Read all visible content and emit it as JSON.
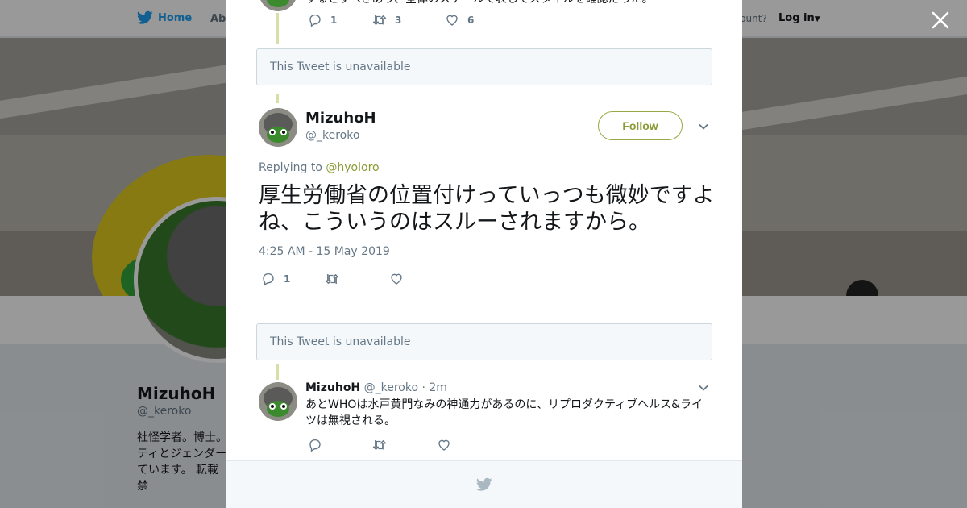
{
  "nav": {
    "home_label": "Home",
    "about_label": "Abo",
    "account_prompt": "ccount?",
    "login_label": "Log in"
  },
  "profile": {
    "name": "MizuhoH",
    "handle": "@_keroko",
    "bio": "社怪学者。博士。\nティとジェンダー\nています。 転載禁\nよ。「占いをまと"
  },
  "colors": {
    "accent": "#8a9a34",
    "thread_line": "#d8dfa6",
    "twitter_blue": "#1da1f2"
  },
  "modal": {
    "top_tweet": {
      "snippet": "するとすべきあり、全体のスケールで表してスタイルを確認だった。",
      "reply_count": "1",
      "retweet_count": "3",
      "like_count": "6"
    },
    "unavailable_1": "This Tweet is unavailable",
    "main_tweet": {
      "name": "MizuhoH",
      "handle": "@_keroko",
      "follow_label": "Follow",
      "replying_prefix": "Replying to",
      "replying_mention": "@hyoloro",
      "text": "厚生労働省の位置付けっていっつも微妙ですよね、こういうのはスルーされますから。",
      "timestamp": "4:25 AM - 15 May 2019",
      "reply_count": "1"
    },
    "unavailable_2": "This Tweet is unavailable",
    "reply_tweet": {
      "name": "MizuhoH",
      "handle": "@_keroko",
      "time": "· 2m",
      "text": "あとWHOは水戸黄門なみの神通力があるのに、リプロダクティブヘルス&ライツは無視される。"
    }
  },
  "icons": {
    "close": "close-icon",
    "bird": "twitter-bird-icon",
    "reply": "reply-icon",
    "retweet": "retweet-icon",
    "like": "heart-icon",
    "chevron": "chevron-down-icon"
  }
}
